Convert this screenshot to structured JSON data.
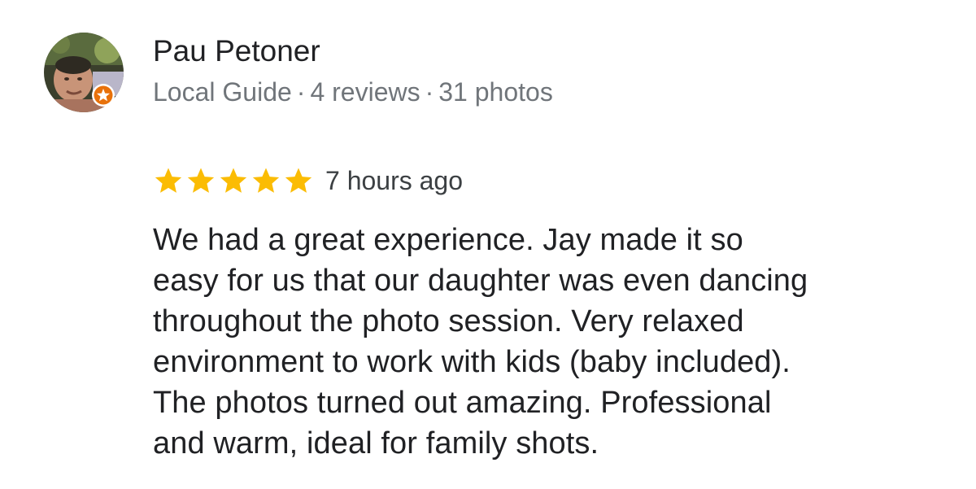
{
  "reviewer": {
    "name": "Pau Petoner",
    "badge": "Local Guide",
    "separator": "·",
    "reviews": "4 reviews",
    "photos": "31 photos",
    "avatar_icon": "profile-photo",
    "badge_icon": "local-guide-star-icon"
  },
  "review": {
    "rating": 5,
    "max_rating": 5,
    "star_color": "#fbbc04",
    "time": "7 hours ago",
    "text_lines": [
      "We had a great experience. Jay made it so",
      "easy for us that our daughter was even dancing",
      "throughout the photo session. Very relaxed",
      "environment to work with kids (baby included).",
      "The photos turned out amazing. Professional",
      "and warm, ideal for family shots."
    ]
  }
}
